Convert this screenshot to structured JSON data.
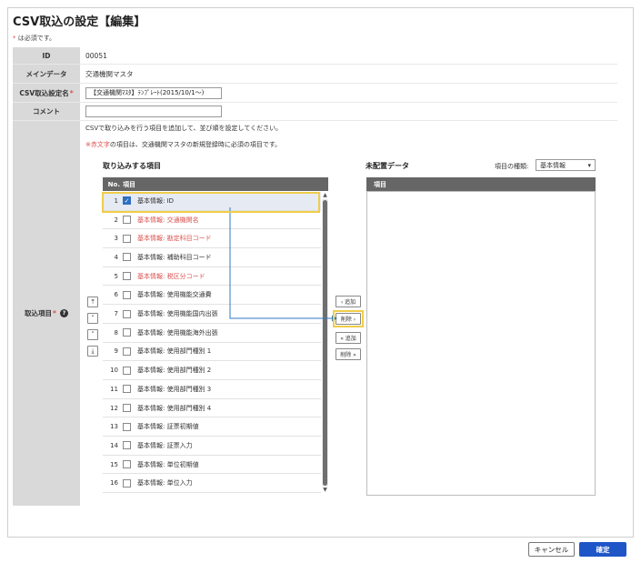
{
  "page": {
    "title": "CSV取込の設定【編集】",
    "required_mark": "*",
    "required_note": " は必須です。"
  },
  "form": {
    "id": {
      "label": "ID",
      "value": "00051"
    },
    "main_data": {
      "label": "メインデータ",
      "value": "交通機関マスタ"
    },
    "csv_name": {
      "label": "CSV取込設定名",
      "value": "【交通機関ﾏｽﾀ】ﾃﾝﾌﾟﾚｰﾄ(2015/10/1～)"
    },
    "comment": {
      "label": "コメント",
      "value": ""
    },
    "items": {
      "label": "取込項目"
    }
  },
  "instructions": {
    "line1": "CSVで取り込みを行う項目を追加して、並び順を設定してください。",
    "red_word": "※赤文字",
    "line2_rest": "の項目は、交通機関マスタの新規登録時に必須の項目です。"
  },
  "left_panel": {
    "title": "取り込みする項目",
    "col_no": "No.",
    "col_item": "項目",
    "items": [
      {
        "no": "1",
        "name": "基本情報: ID",
        "checked": true,
        "red": false
      },
      {
        "no": "2",
        "name": "基本情報: 交通機関名",
        "checked": false,
        "red": true
      },
      {
        "no": "3",
        "name": "基本情報: 勘定科目コード",
        "checked": false,
        "red": true
      },
      {
        "no": "4",
        "name": "基本情報: 補助科目コード",
        "checked": false,
        "red": false
      },
      {
        "no": "5",
        "name": "基本情報: 税区分コード",
        "checked": false,
        "red": true
      },
      {
        "no": "6",
        "name": "基本情報: 使用機能交通費",
        "checked": false,
        "red": false
      },
      {
        "no": "7",
        "name": "基本情報: 使用機能国内出張",
        "checked": false,
        "red": false
      },
      {
        "no": "8",
        "name": "基本情報: 使用機能海外出張",
        "checked": false,
        "red": false
      },
      {
        "no": "9",
        "name": "基本情報: 使用部門種別 1",
        "checked": false,
        "red": false
      },
      {
        "no": "10",
        "name": "基本情報: 使用部門種別 2",
        "checked": false,
        "red": false
      },
      {
        "no": "11",
        "name": "基本情報: 使用部門種別 3",
        "checked": false,
        "red": false
      },
      {
        "no": "12",
        "name": "基本情報: 使用部門種別 4",
        "checked": false,
        "red": false
      },
      {
        "no": "13",
        "name": "基本情報: 証票初期値",
        "checked": false,
        "red": false
      },
      {
        "no": "14",
        "name": "基本情報: 証票入力",
        "checked": false,
        "red": false
      },
      {
        "no": "15",
        "name": "基本情報: 単位初期値",
        "checked": false,
        "red": false
      },
      {
        "no": "16",
        "name": "基本情報: 単位入力",
        "checked": false,
        "red": false
      }
    ]
  },
  "order_buttons": {
    "top": "⤒",
    "up": "˄",
    "down": "˅",
    "bottom": "⤓"
  },
  "middle_buttons": {
    "add": "‹ 追加",
    "remove": "削除 ›",
    "add_all": "« 追加",
    "remove_all": "削除 »"
  },
  "right_panel": {
    "title": "未配置データ",
    "type_label": "項目の種類:",
    "type_value": "基本情報",
    "col_item": "項目"
  },
  "footer": {
    "cancel": "キャンセル",
    "ok": "確定"
  },
  "colors": {
    "accent": "#1e56c8",
    "highlight": "#f0cd4a",
    "required_red": "#d9534f",
    "check_blue": "#2f6fbf"
  }
}
